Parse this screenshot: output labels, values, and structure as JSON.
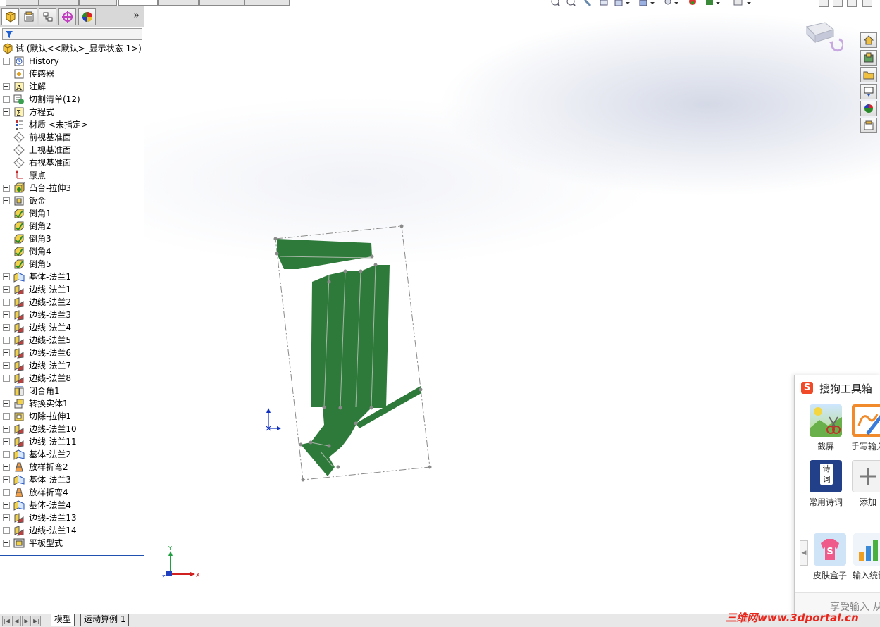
{
  "feature_tree": {
    "root_label": "试 (默认<<默认>_显示状态 1>)",
    "items": [
      {
        "label": "History",
        "icon": "history-icon",
        "expandable": true
      },
      {
        "label": "传感器",
        "icon": "sensor-icon",
        "expandable": false
      },
      {
        "label": "注解",
        "icon": "annotation-icon",
        "expandable": true
      },
      {
        "label": "切割清单(12)",
        "icon": "cut-list-icon",
        "expandable": true
      },
      {
        "label": "方程式",
        "icon": "equation-icon",
        "expandable": true
      },
      {
        "label": "材质 <未指定>",
        "icon": "material-icon",
        "expandable": false
      },
      {
        "label": "前视基准面",
        "icon": "plane-icon",
        "expandable": false
      },
      {
        "label": "上视基准面",
        "icon": "plane-icon",
        "expandable": false
      },
      {
        "label": "右视基准面",
        "icon": "plane-icon",
        "expandable": false
      },
      {
        "label": "原点",
        "icon": "origin-icon",
        "expandable": false
      },
      {
        "label": "凸台-拉伸3",
        "icon": "extrude-icon",
        "expandable": true
      },
      {
        "label": "钣金",
        "icon": "sheet-metal-icon",
        "expandable": true
      },
      {
        "label": "倒角1",
        "icon": "chamfer-icon",
        "expandable": false
      },
      {
        "label": "倒角2",
        "icon": "chamfer-icon",
        "expandable": false
      },
      {
        "label": "倒角3",
        "icon": "chamfer-icon",
        "expandable": false
      },
      {
        "label": "倒角4",
        "icon": "chamfer-icon",
        "expandable": false
      },
      {
        "label": "倒角5",
        "icon": "chamfer-icon",
        "expandable": false
      },
      {
        "label": "基体-法兰1",
        "icon": "base-flange-icon",
        "expandable": true
      },
      {
        "label": "边线-法兰1",
        "icon": "edge-flange-icon",
        "expandable": true
      },
      {
        "label": "边线-法兰2",
        "icon": "edge-flange-icon",
        "expandable": true
      },
      {
        "label": "边线-法兰3",
        "icon": "edge-flange-icon",
        "expandable": true
      },
      {
        "label": "边线-法兰4",
        "icon": "edge-flange-icon",
        "expandable": true
      },
      {
        "label": "边线-法兰5",
        "icon": "edge-flange-icon",
        "expandable": true
      },
      {
        "label": "边线-法兰6",
        "icon": "edge-flange-icon",
        "expandable": true
      },
      {
        "label": "边线-法兰7",
        "icon": "edge-flange-icon",
        "expandable": true
      },
      {
        "label": "边线-法兰8",
        "icon": "edge-flange-icon",
        "expandable": true
      },
      {
        "label": "闭合角1",
        "icon": "closed-corner-icon",
        "expandable": false
      },
      {
        "label": "转换实体1",
        "icon": "convert-entity-icon",
        "expandable": true
      },
      {
        "label": "切除-拉伸1",
        "icon": "cut-extrude-icon",
        "expandable": true
      },
      {
        "label": "边线-法兰10",
        "icon": "edge-flange-icon",
        "expandable": true
      },
      {
        "label": "边线-法兰11",
        "icon": "edge-flange-icon",
        "expandable": true
      },
      {
        "label": "基体-法兰2",
        "icon": "base-flange-icon",
        "expandable": true
      },
      {
        "label": "放样折弯2",
        "icon": "lofted-bend-icon",
        "expandable": true
      },
      {
        "label": "基体-法兰3",
        "icon": "base-flange-icon",
        "expandable": true
      },
      {
        "label": "放样折弯4",
        "icon": "lofted-bend-icon",
        "expandable": true
      },
      {
        "label": "基体-法兰4",
        "icon": "base-flange-icon",
        "expandable": true
      },
      {
        "label": "边线-法兰13",
        "icon": "edge-flange-icon",
        "expandable": true
      },
      {
        "label": "边线-法兰14",
        "icon": "edge-flange-icon",
        "expandable": true
      },
      {
        "label": "平板型式",
        "icon": "flat-pattern-icon",
        "expandable": true
      }
    ]
  },
  "bottom_tabs": [
    "模型",
    "运动算例 1"
  ],
  "triad": {
    "x": "X",
    "y": "Y",
    "z": "Z"
  },
  "sogou": {
    "title": "搜狗工具箱",
    "tools": [
      {
        "label": "截屏",
        "icon": "screenshot-icon"
      },
      {
        "label": "手写输入",
        "icon": "handwriting-icon"
      },
      {
        "label": "常用诗词",
        "icon": "poetry-icon",
        "glyph": "诗词"
      },
      {
        "label": "添加",
        "icon": "add-icon"
      },
      {
        "label": "皮肤盒子",
        "icon": "skin-box-icon"
      },
      {
        "label": "输入统计",
        "icon": "input-stats-icon"
      }
    ],
    "footer": "享受输入 从"
  },
  "watermark": "三维网www.3dportal.cn",
  "colors": {
    "part_fill": "#2e7a3a",
    "part_edge": "#8a9a8a",
    "selection_blue": "#2050b0",
    "sogou_orange": "#f04a28"
  }
}
